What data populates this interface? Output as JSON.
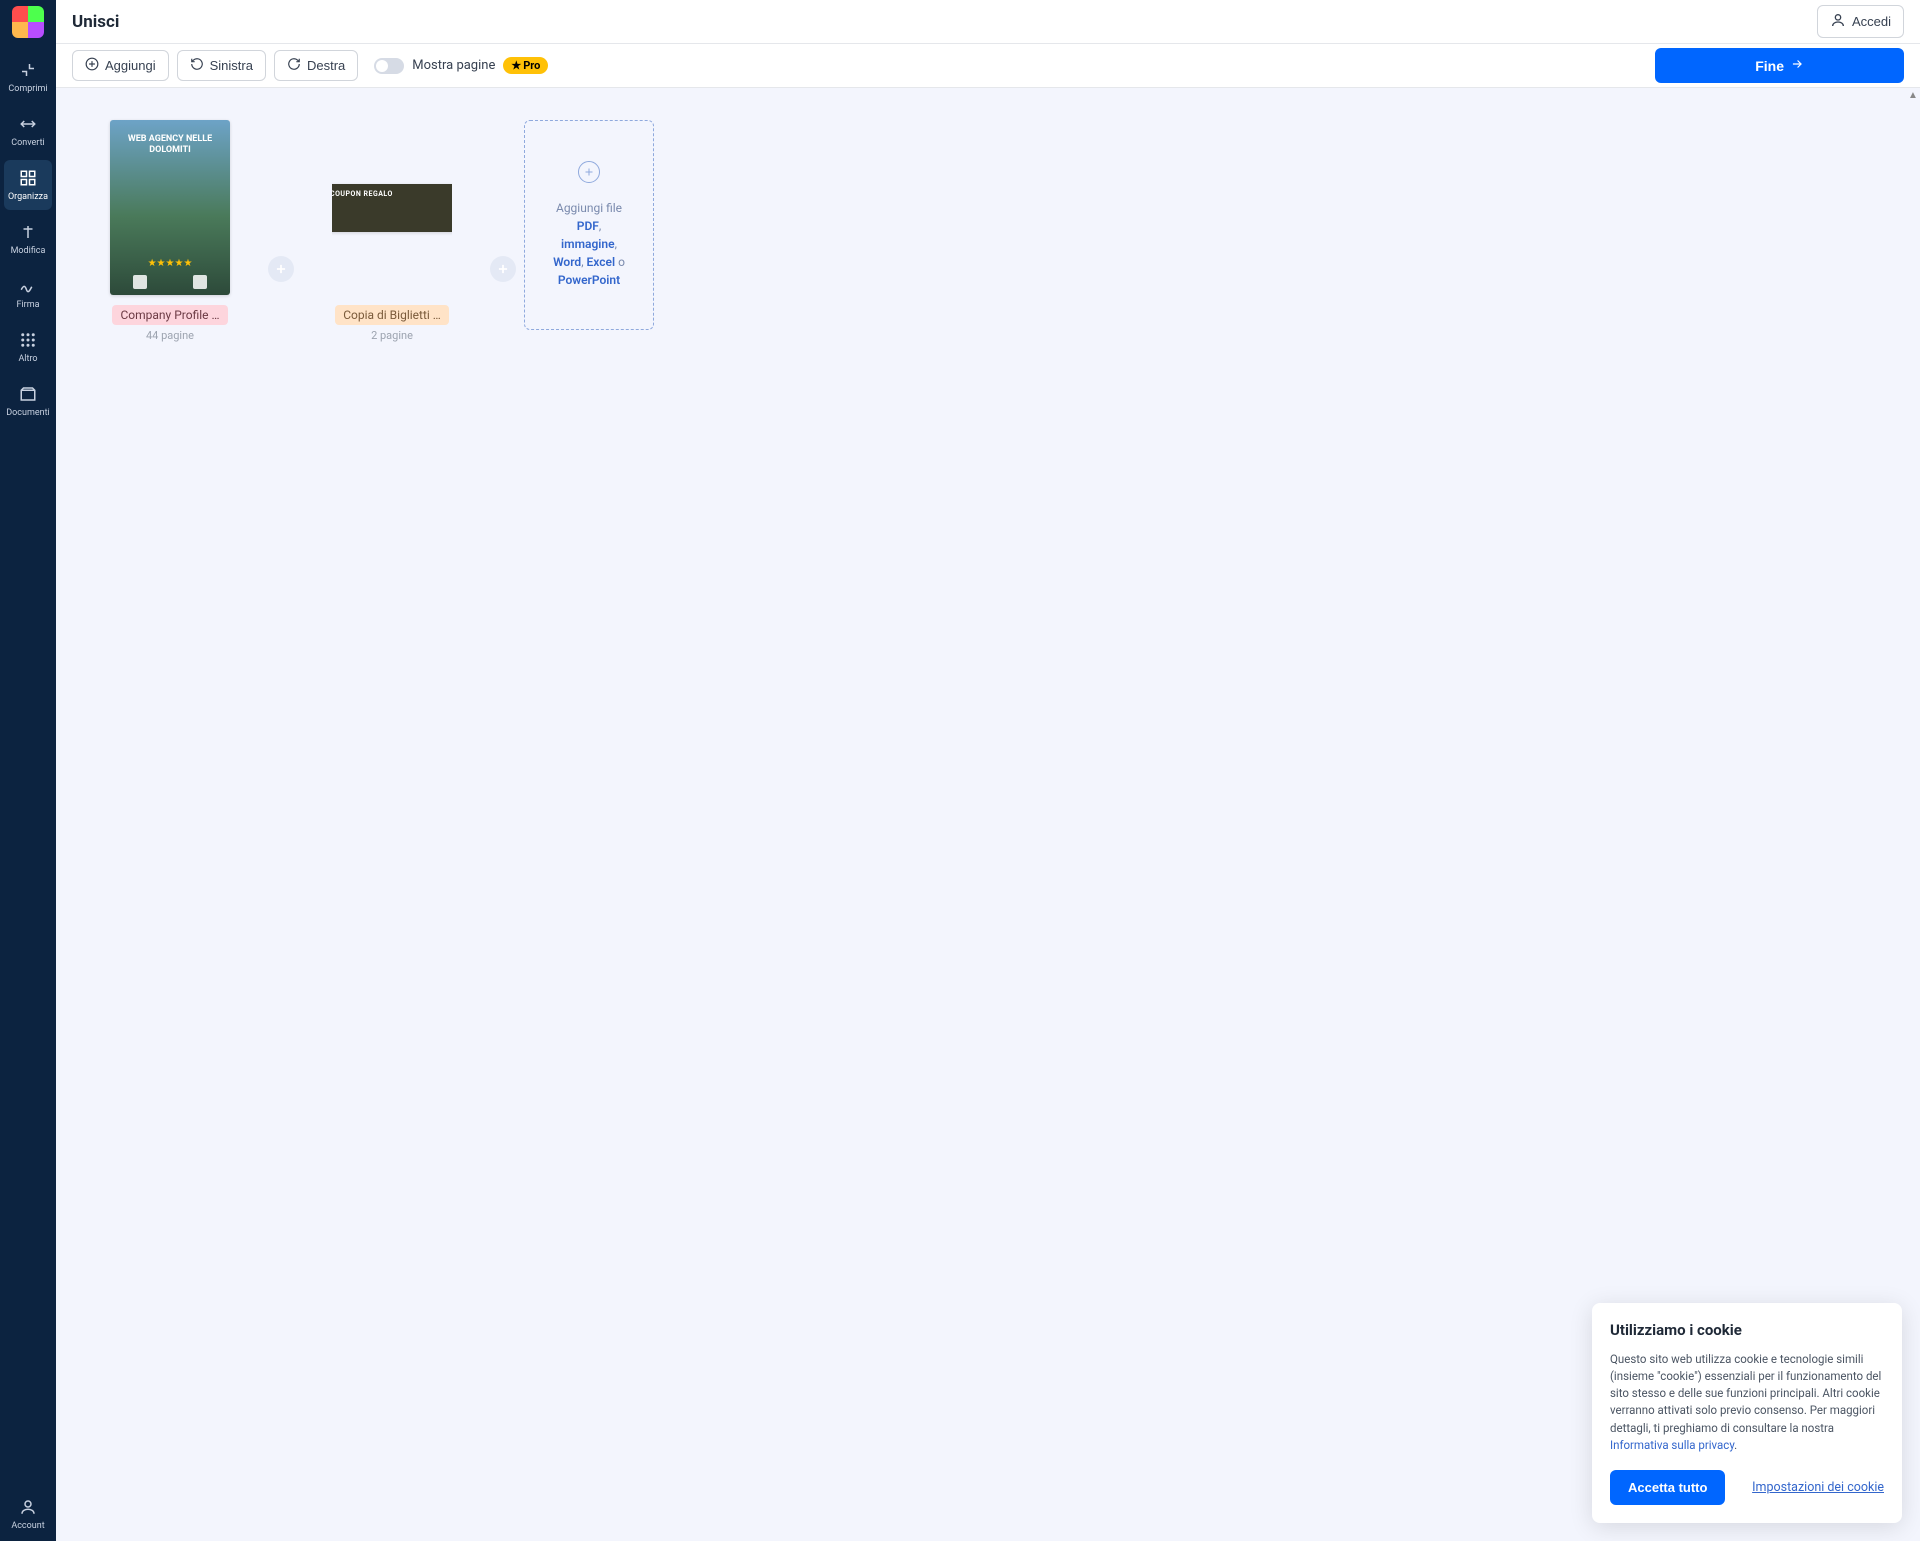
{
  "header": {
    "title": "Unisci",
    "login": "Accedi"
  },
  "sidebar": {
    "items": [
      {
        "label": "Comprimi"
      },
      {
        "label": "Converti"
      },
      {
        "label": "Organizza"
      },
      {
        "label": "Modifica"
      },
      {
        "label": "Firma"
      },
      {
        "label": "Altro"
      },
      {
        "label": "Documenti"
      }
    ],
    "account": "Account"
  },
  "toolbar": {
    "add": "Aggiungi",
    "left": "Sinistra",
    "right": "Destra",
    "show_pages": "Mostra pagine",
    "pro": "Pro",
    "finish": "Fine"
  },
  "files": [
    {
      "name": "Company Profile …",
      "pages": "44 pagine",
      "thumb_title": "WEB AGENCY NELLE DOLOMITI"
    },
    {
      "name": "Copia di Biglietti …",
      "pages": "2 pagine",
      "thumb_title": "COUPON REGALO"
    }
  ],
  "add_zone": {
    "prefix": "Aggiungi file",
    "pdf": "PDF",
    "image": "immagine",
    "word": "Word",
    "excel": "Excel",
    "or": "o",
    "ppt": "PowerPoint"
  },
  "cookie": {
    "title": "Utilizziamo i cookie",
    "body_before": "Questo sito web utilizza cookie e tecnologie simili (insieme \"cookie\") essenziali per il funzionamento del sito stesso e delle sue funzioni principali. Altri cookie verranno attivati solo previo consenso. Per maggiori dettagli, ti preghiamo di consultare la nostra ",
    "privacy": "Informativa sulla privacy",
    "body_after": ".",
    "accept": "Accetta tutto",
    "settings": "Impostazioni dei cookie"
  }
}
